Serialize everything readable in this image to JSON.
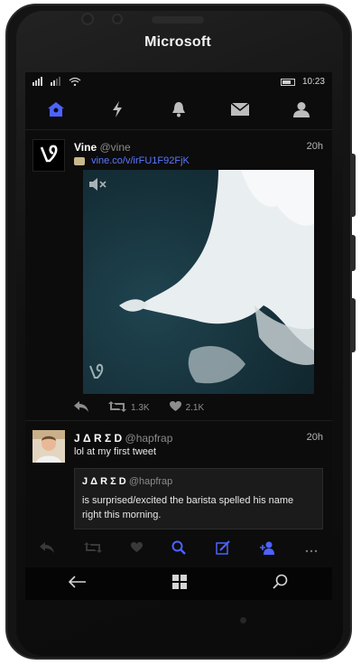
{
  "device": {
    "brand": "Microsoft"
  },
  "status_bar": {
    "time": "10:23"
  },
  "tabs": [
    {
      "icon": "home-icon"
    },
    {
      "icon": "lightning-icon"
    },
    {
      "icon": "bell-icon"
    },
    {
      "icon": "mail-icon"
    },
    {
      "icon": "person-icon"
    }
  ],
  "tweets": [
    {
      "name": "Vine",
      "handle": "@vine",
      "time": "20h",
      "link": "vine.co/v/irFU1F92FjK",
      "retweets": "1.3K",
      "likes": "2.1K"
    },
    {
      "name": "J Δ R Σ D",
      "handle": "@hapfrap",
      "time": "20h",
      "text": "lol at my first tweet",
      "quote": {
        "name": "J Δ R Σ D",
        "handle": "@hapfrap",
        "text_line1": "is surprised/excited the barista spelled his name",
        "text_line2": "right this morning."
      }
    }
  ],
  "colors": {
    "accent": "#4c63ff",
    "background": "#0c0c0c"
  }
}
